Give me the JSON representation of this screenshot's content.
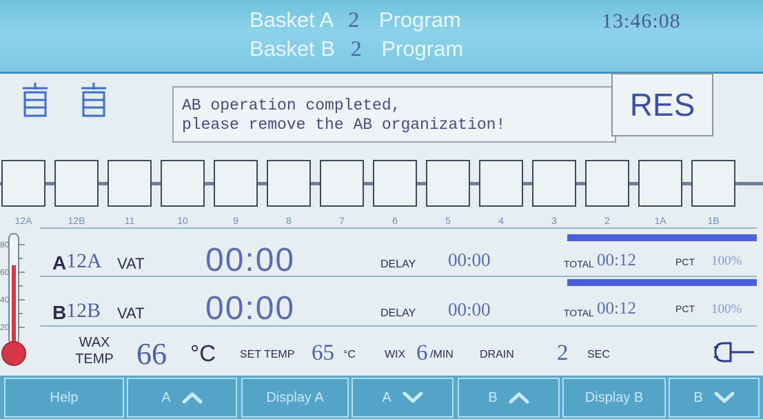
{
  "header": {
    "basket_a_label": "Basket A",
    "basket_a_num": "2",
    "basket_a_program": "Program",
    "basket_b_label": "Basket B",
    "basket_b_num": "2",
    "basket_b_program": "Program",
    "clock": "13:46:08"
  },
  "message": {
    "line1": "AB operation completed,",
    "line2": "please remove the AB organization!",
    "res_label": "RES"
  },
  "stations": [
    "12A",
    "12B",
    "11",
    "10",
    "9",
    "8",
    "7",
    "6",
    "5",
    "4",
    "3",
    "2",
    "1A",
    "1B"
  ],
  "thermometer_ticks": [
    "80",
    "60",
    "40",
    "20"
  ],
  "row_a": {
    "letter": "A",
    "code": "12A",
    "vat": "VAT",
    "timer": "00:00",
    "delay_label": "DELAY",
    "delay": "00:00",
    "total_label": "TOTAL",
    "total": "00:12",
    "pct_label": "PCT",
    "pct": "100%",
    "progress": 100
  },
  "row_b": {
    "letter": "B",
    "code": "12B",
    "vat": "VAT",
    "timer": "00:00",
    "delay_label": "DELAY",
    "delay": "00:00",
    "total_label": "TOTAL",
    "total": "00:12",
    "pct_label": "PCT",
    "pct": "100%",
    "progress": 100
  },
  "wax": {
    "label_top": "WAX",
    "label_bottom": "TEMP",
    "temp": "66",
    "temp_unit": "°C",
    "set_label": "SET TEMP",
    "set_temp": "65",
    "set_unit": "°C",
    "wix_label": "WIX",
    "wix_value": "6",
    "wix_unit": "/MIN",
    "drain_label": "DRAIN",
    "drain_value": "2",
    "drain_unit": "SEC"
  },
  "buttons": {
    "help": "Help",
    "a_up": "A",
    "display_a": "Display A",
    "a_down": "A",
    "b_up": "B",
    "display_b": "Display B",
    "b_down": "B"
  },
  "colors": {
    "header": "#7cc9e3",
    "accent": "#4b5fd8",
    "thermometer": "#d63848",
    "button": "#54a4c8"
  }
}
